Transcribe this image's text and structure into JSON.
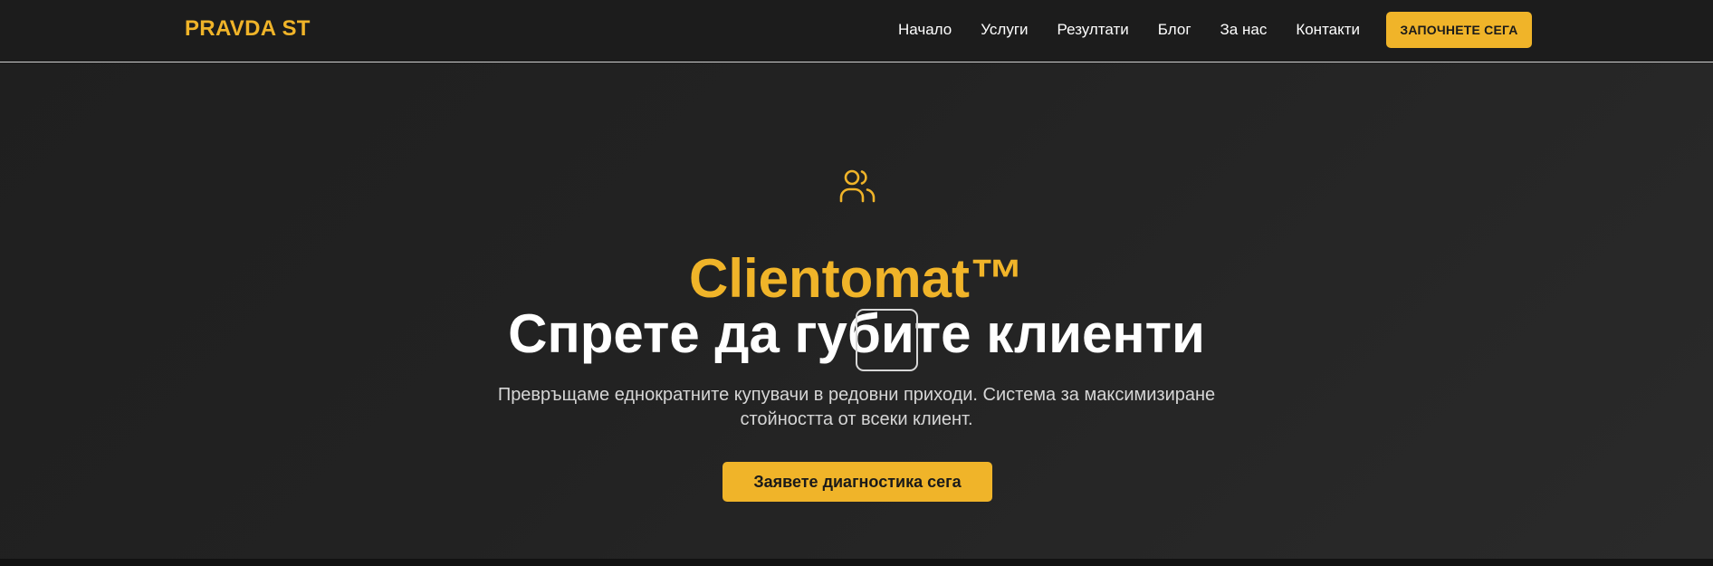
{
  "nav": {
    "logo": "PRAVDA ST",
    "items": [
      {
        "label": "Начало"
      },
      {
        "label": "Услуги"
      },
      {
        "label": "Резултати"
      },
      {
        "label": "Блог"
      },
      {
        "label": "За нас"
      },
      {
        "label": "Контакти"
      }
    ],
    "cta_label": "ЗАПОЧНЕТЕ СЕГА"
  },
  "hero": {
    "icon": "users-icon",
    "brand": "Clientomat™",
    "headline": "Спрете да губите клиенти",
    "subtext_line1": "Превръщаме еднократните купувачи в редовни приходи. Система за максимизиране",
    "subtext_line2": "стойността от всеки клиент.",
    "cta_label": "Заявете диагностика сега"
  },
  "colors": {
    "accent": "#f0b429",
    "background": "#1c1c1c",
    "text": "#ffffff"
  }
}
